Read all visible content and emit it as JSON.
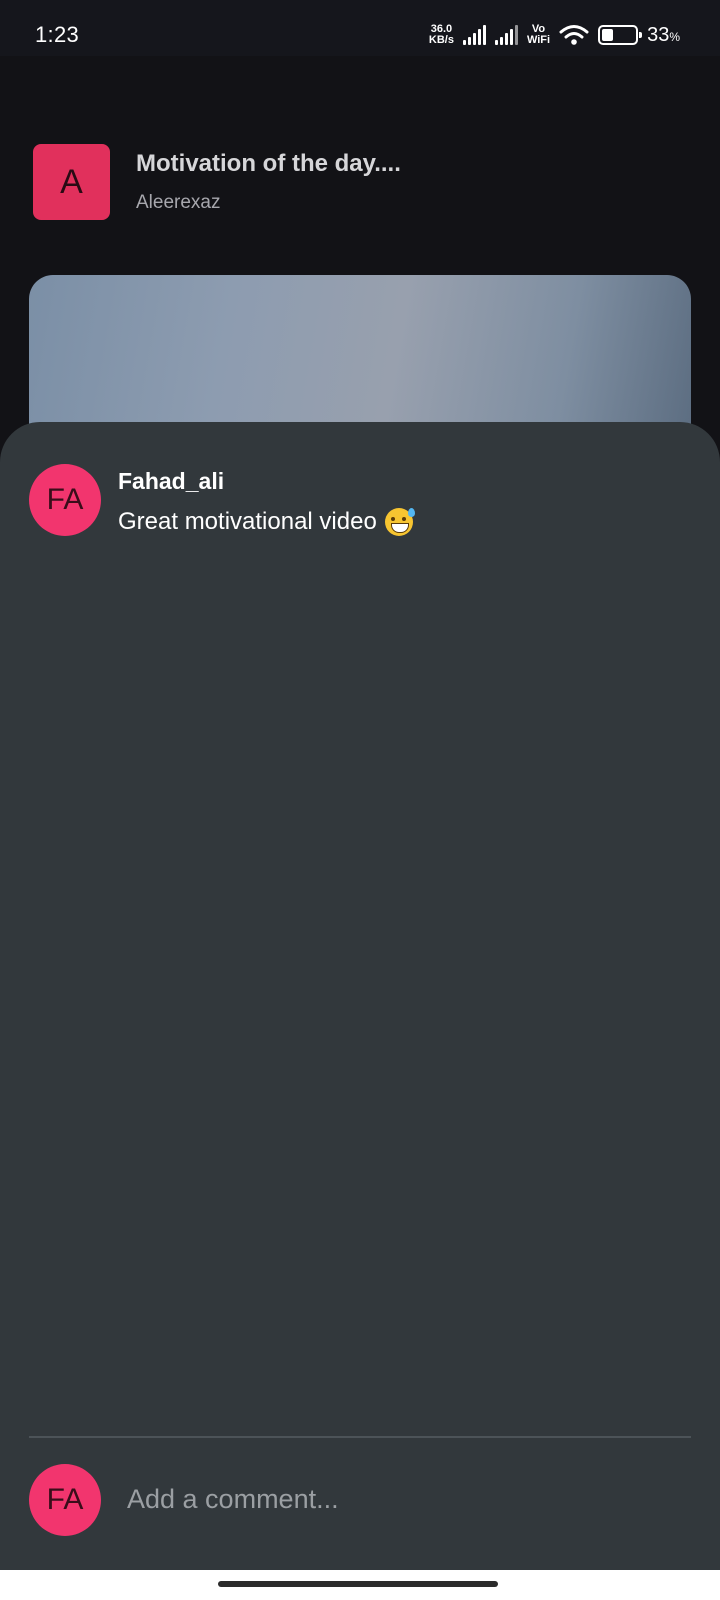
{
  "status_bar": {
    "time": "1:23",
    "net_speed_value": "36.0",
    "net_speed_unit": "KB/s",
    "vo_label": "Vo",
    "wifi_label": "WiFi",
    "battery_level": 0.33,
    "battery_percent": "33",
    "battery_unit": "%"
  },
  "post": {
    "avatar_initial": "A",
    "title": "Motivation of the day....",
    "author": "Aleerexaz"
  },
  "comments": [
    {
      "avatar_initials": "FA",
      "username": "Fahad_ali",
      "text": "Great motivational video",
      "emoji": "grinning-face-with-sweat-icon"
    }
  ],
  "composer": {
    "avatar_initials": "FA",
    "placeholder": "Add a comment..."
  },
  "colors": {
    "accent": "#f2356e",
    "post_avatar": "#e1305c",
    "sheet_background": "#32383c",
    "page_background": "#121216"
  }
}
